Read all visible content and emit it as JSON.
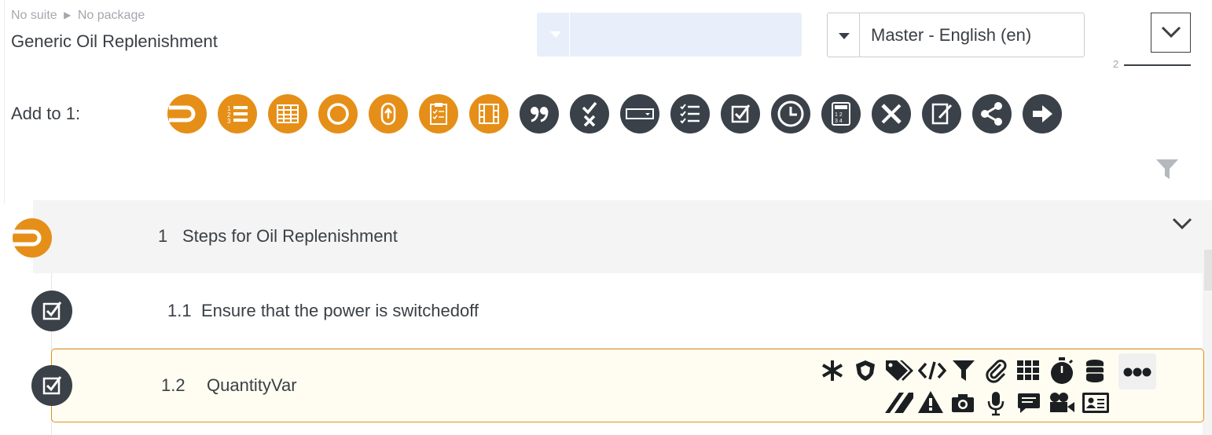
{
  "breadcrumb": {
    "suite": "No suite",
    "separator": "▶",
    "package": "No package"
  },
  "page_title": "Generic Oil Replenishment",
  "language_select": {
    "value": "Master - English (en)"
  },
  "level_indicator": "2",
  "add_to": {
    "label": "Add to 1:",
    "icons": [
      {
        "name": "section-icon",
        "color": "#e58f18"
      },
      {
        "name": "numbered-list-icon",
        "color": "#e58f18"
      },
      {
        "name": "table-icon",
        "color": "#e58f18"
      },
      {
        "name": "circle-icon",
        "color": "#e58f18"
      },
      {
        "name": "loop-icon",
        "color": "#e58f18"
      },
      {
        "name": "checklist-clipboard-icon",
        "color": "#e58f18"
      },
      {
        "name": "film-grid-icon",
        "color": "#e58f18"
      },
      {
        "name": "quote-icon",
        "color": "#3a4149"
      },
      {
        "name": "check-cross-icon",
        "color": "#3a4149"
      },
      {
        "name": "dropdown-field-icon",
        "color": "#3a4149"
      },
      {
        "name": "checklist-icon",
        "color": "#3a4149"
      },
      {
        "name": "checkbox-icon",
        "color": "#3a4149"
      },
      {
        "name": "clock-icon",
        "color": "#3a4149"
      },
      {
        "name": "calculator-icon",
        "color": "#3a4149"
      },
      {
        "name": "ruler-pencil-icon",
        "color": "#3a4149"
      },
      {
        "name": "signature-icon",
        "color": "#3a4149"
      },
      {
        "name": "share-icon",
        "color": "#3a4149"
      },
      {
        "name": "arrow-right-icon",
        "color": "#3a4149"
      }
    ]
  },
  "section": {
    "number": "1",
    "title": "Steps for Oil Replenishment"
  },
  "steps": [
    {
      "number": "1.1",
      "title": "Ensure that the power is switchedoff"
    },
    {
      "number": "1.2",
      "title": "QuantityVar"
    }
  ],
  "row_tools": {
    "top": [
      "asterisk-icon",
      "shield-icon",
      "tags-icon",
      "code-icon",
      "filter-icon",
      "paperclip-icon",
      "grid-icon",
      "stopwatch-icon",
      "database-icon"
    ],
    "bottom": [
      "slash-lines-icon",
      "warning-icon",
      "camera-icon",
      "microphone-icon",
      "comment-icon",
      "video-camera-icon",
      "id-card-icon"
    ],
    "more": "more-icon"
  },
  "colors": {
    "accent": "#e58f18",
    "dark": "#3a4149",
    "text": "#3a3f45",
    "muted": "#a3a8ae",
    "select_empty_bg": "#e8effa",
    "selected_row_bg": "#fffdf1"
  }
}
